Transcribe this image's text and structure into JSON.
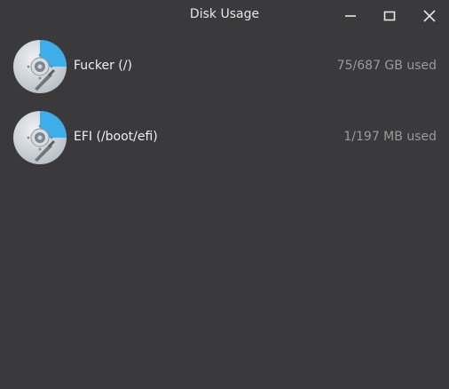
{
  "window": {
    "title": "Disk Usage"
  },
  "disks": [
    {
      "name": "Fucker (/)",
      "usage": "75/687 GB used",
      "used_fraction": 0.11,
      "icon": "hard-disk-icon"
    },
    {
      "name": "EFI (/boot/efi)",
      "usage": "1/197 MB used",
      "used_fraction": 0.01,
      "icon": "hard-disk-icon"
    }
  ],
  "colors": {
    "background": "#3a3a3c",
    "accent": "#3daee9",
    "text": "#f0f0f0",
    "muted_text": "#9a9a9a"
  }
}
